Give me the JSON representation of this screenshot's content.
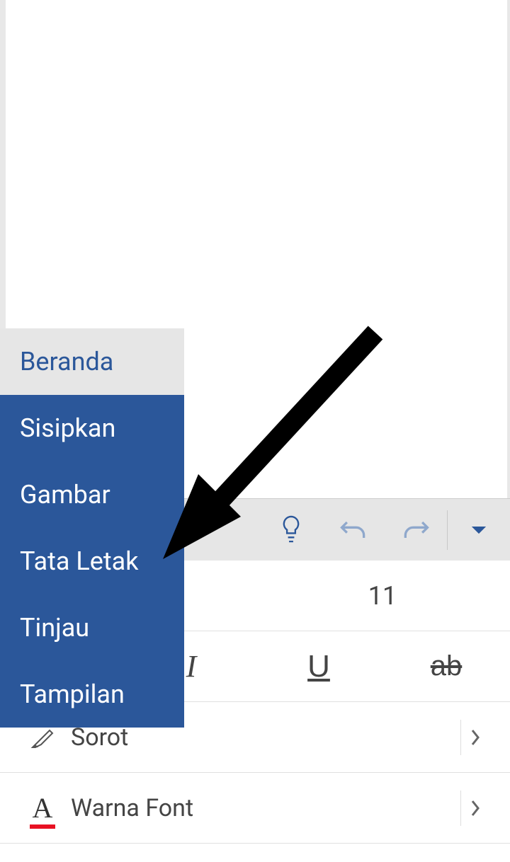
{
  "dropdown": {
    "items": [
      {
        "label": "Beranda",
        "active": true
      },
      {
        "label": "Sisipkan",
        "active": false
      },
      {
        "label": "Gambar",
        "active": false
      },
      {
        "label": "Tata Letak",
        "active": false
      },
      {
        "label": "Tinjau",
        "active": false
      },
      {
        "label": "Tampilan",
        "active": false
      }
    ]
  },
  "ribbon": {
    "lightbulb": "lightbulb",
    "undo": "undo",
    "redo": "redo",
    "caret": "caret"
  },
  "formatting": {
    "font_size": "11",
    "italic": "I",
    "underline": "U",
    "strike": "ab"
  },
  "list_rows": {
    "highlight": {
      "label": "Sorot"
    },
    "font_color": {
      "label": "Warna Font",
      "glyph": "A"
    }
  }
}
